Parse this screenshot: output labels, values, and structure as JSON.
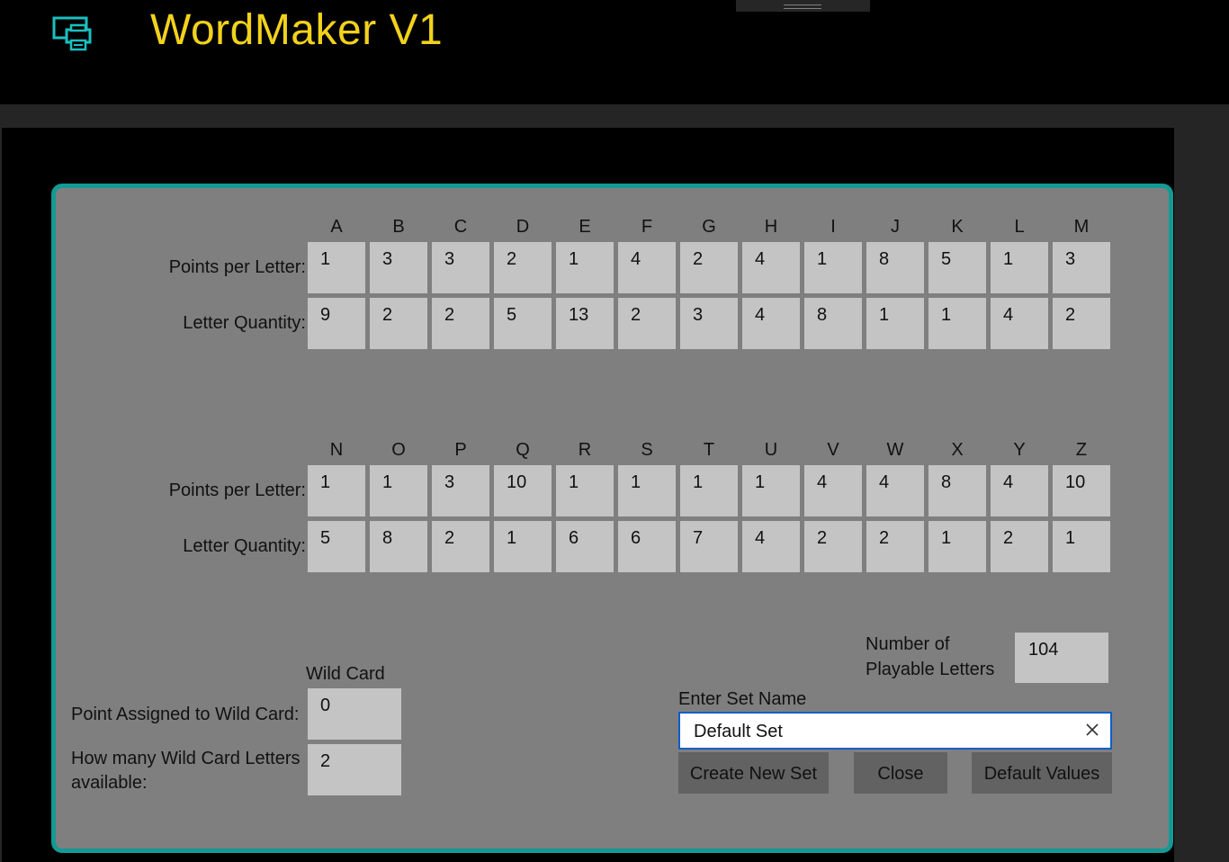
{
  "app": {
    "title": "WordMaker V1",
    "icon": "window-printer-icon"
  },
  "colors": {
    "accent": "#149a94",
    "title": "#f2d21c",
    "panel": "#7f7f7f",
    "cell": "#c4c4c4",
    "button": "#626262",
    "focus_border": "#0b5fc6"
  },
  "labels": {
    "points": "Points per Letter:",
    "quantity": "Letter Quantity:"
  },
  "block1": {
    "letters": [
      "A",
      "B",
      "C",
      "D",
      "E",
      "F",
      "G",
      "H",
      "I",
      "J",
      "K",
      "L",
      "M"
    ],
    "points": [
      "1",
      "3",
      "3",
      "2",
      "1",
      "4",
      "2",
      "4",
      "1",
      "8",
      "5",
      "1",
      "3"
    ],
    "quantity": [
      "9",
      "2",
      "2",
      "5",
      "13",
      "2",
      "3",
      "4",
      "8",
      "1",
      "1",
      "4",
      "2"
    ]
  },
  "block2": {
    "letters": [
      "N",
      "O",
      "P",
      "Q",
      "R",
      "S",
      "T",
      "U",
      "V",
      "W",
      "X",
      "Y",
      "Z"
    ],
    "points": [
      "1",
      "1",
      "3",
      "10",
      "1",
      "1",
      "1",
      "1",
      "4",
      "4",
      "8",
      "4",
      "10"
    ],
    "quantity": [
      "5",
      "8",
      "2",
      "1",
      "6",
      "6",
      "7",
      "4",
      "2",
      "2",
      "1",
      "2",
      "1"
    ]
  },
  "wildcard": {
    "header": "Wild Card",
    "points_label": "Point Assigned to Wild Card:",
    "points_value": "0",
    "count_label_1": "How many Wild Card Letters",
    "count_label_2": "available:",
    "count_value": "2"
  },
  "playable": {
    "label_1": "Number of",
    "label_2": "Playable Letters",
    "value": "104"
  },
  "set": {
    "label": "Enter Set Name",
    "value": "Default Set"
  },
  "buttons": {
    "create": "Create New Set",
    "close": "Close",
    "defaults": "Default Values"
  }
}
